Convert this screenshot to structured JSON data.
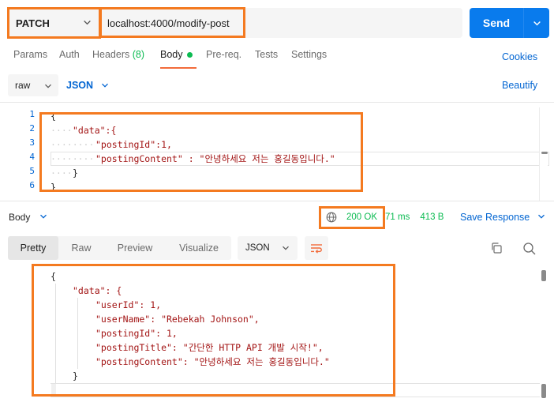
{
  "request": {
    "method": "PATCH",
    "url": "localhost:4000/modify-post",
    "send_label": "Send"
  },
  "tabs": [
    {
      "label": "Params"
    },
    {
      "label": "Auth"
    },
    {
      "label": "Headers",
      "count": "(8)"
    },
    {
      "label": "Body",
      "active": true
    },
    {
      "label": "Pre-req."
    },
    {
      "label": "Tests"
    },
    {
      "label": "Settings"
    }
  ],
  "cookies_label": "Cookies",
  "body_options": {
    "mode": "raw",
    "language": "JSON",
    "beautify_label": "Beautify"
  },
  "request_body": {
    "line_numbers": [
      "1",
      "2",
      "3",
      "4",
      "5",
      "6"
    ],
    "lines": [
      "{",
      "\"data\":{",
      "\"postingId\":1,",
      "\"postingContent\" : \"안녕하세요 저는 홍길동입니다.\"",
      "}",
      "}"
    ]
  },
  "response": {
    "body_label": "Body",
    "status": "200 OK",
    "time": "71 ms",
    "size": "413 B",
    "save_label": "Save Response",
    "tabs": [
      "Pretty",
      "Raw",
      "Preview",
      "Visualize"
    ],
    "active_tab": "Pretty",
    "format": "JSON",
    "lines": [
      "{",
      "\"data\": {",
      "\"userId\": 1,",
      "\"userName\": \"Rebekah Johnson\",",
      "\"postingId\": 1,",
      "\"postingTitle\": \"간단한 HTTP API 개발 시작!\",",
      "\"postingContent\": \"안녕하세요 저는 홍길동입니다.\"",
      "}",
      "}"
    ]
  },
  "colors": {
    "accent_orange": "#f47a20",
    "send_blue": "#097bed",
    "link_blue": "#0265d2",
    "status_green": "#0cbb52",
    "tab_underline": "#f26b3a"
  }
}
